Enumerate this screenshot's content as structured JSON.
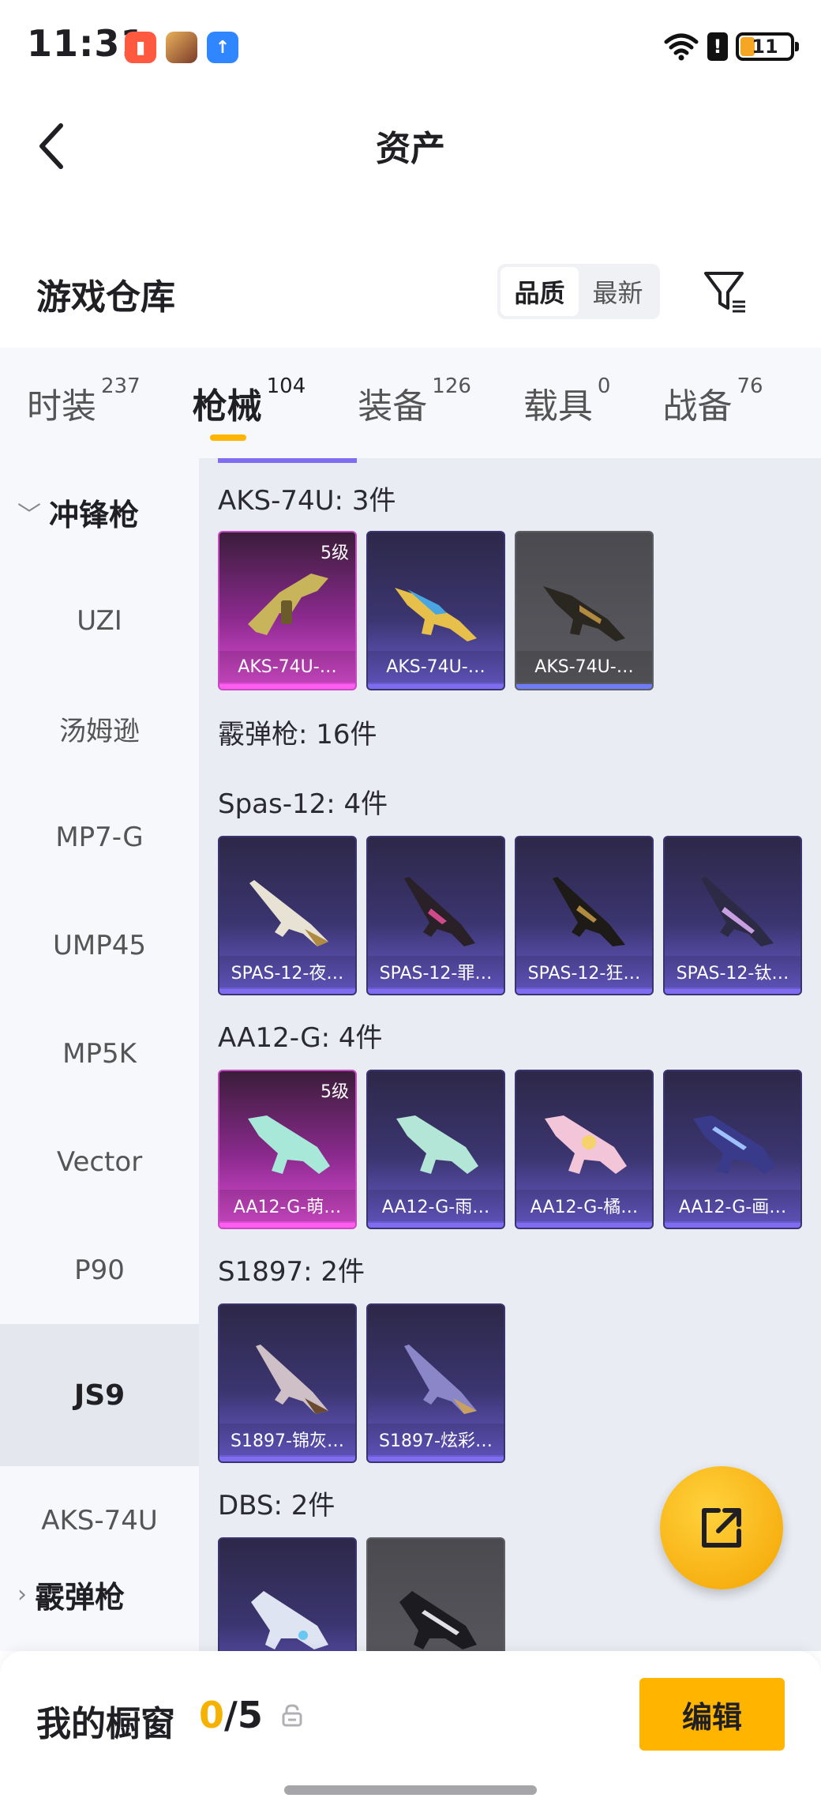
{
  "status_bar": {
    "time": "11:31",
    "battery": "11",
    "alert": "!"
  },
  "header": {
    "title": "资产"
  },
  "section": {
    "title": "游戏仓库",
    "sort_options": [
      "品质",
      "最新"
    ]
  },
  "tabs": [
    {
      "label": "时装",
      "count": "237"
    },
    {
      "label": "枪械",
      "count": "104",
      "active": true
    },
    {
      "label": "装备",
      "count": "126"
    },
    {
      "label": "载具",
      "count": "0"
    },
    {
      "label": "战备",
      "count": "76"
    }
  ],
  "sidebar": {
    "group_smg": "冲锋枪",
    "items": [
      "UZI",
      "汤姆逊",
      "MP7-G",
      "UMP45",
      "MP5K",
      "Vector",
      "P90",
      "JS9",
      "AKS-74U"
    ],
    "selected": "JS9",
    "group_shotgun": "霰弹枪"
  },
  "content": {
    "aks_group": {
      "title": "AKS-74U: 3件",
      "cards": [
        {
          "label": "AKS-74U-…",
          "badge": "5级"
        },
        {
          "label": "AKS-74U-…"
        },
        {
          "label": "AKS-74U-…"
        }
      ]
    },
    "shotgun_header": "霰弹枪: 16件",
    "spas_group": {
      "title": "Spas-12: 4件",
      "cards": [
        {
          "label": "SPAS-12-夜…"
        },
        {
          "label": "SPAS-12-罪…"
        },
        {
          "label": "SPAS-12-狂…"
        },
        {
          "label": "SPAS-12-钛…"
        }
      ]
    },
    "aa12_group": {
      "title": "AA12-G: 4件",
      "cards": [
        {
          "label": "AA12-G-萌…",
          "badge": "5级"
        },
        {
          "label": "AA12-G-雨…"
        },
        {
          "label": "AA12-G-橘…"
        },
        {
          "label": "AA12-G-画…"
        }
      ]
    },
    "s1897_group": {
      "title": "S1897: 2件",
      "cards": [
        {
          "label": "S1897-锦灰…"
        },
        {
          "label": "S1897-炫彩…"
        }
      ]
    },
    "dbs_group": {
      "title": "DBS: 2件"
    }
  },
  "bottom_bar": {
    "label": "我的橱窗",
    "current": "0",
    "total": "/5",
    "edit_label": "编辑"
  },
  "colors": {
    "accent": "#ffb400",
    "legendary": "#e04fd6",
    "epic": "#6d5fd4",
    "gray": "#5a5a60"
  }
}
